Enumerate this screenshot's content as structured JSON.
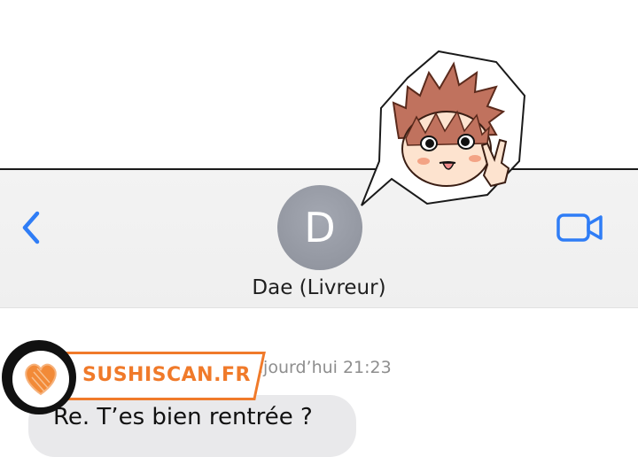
{
  "header": {
    "contact_initial": "D",
    "contact_name": "Dae (Livreur)",
    "back_icon": "chevron-left-icon",
    "video_icon": "video-camera-icon",
    "accent_color": "#2f7df6"
  },
  "conversation": {
    "timestamp": "ujourd’hui 21:23",
    "messages": [
      {
        "text": "Re. T’es bien rentrée ?",
        "direction": "incoming"
      }
    ]
  },
  "watermark": {
    "text": "SUSHISCAN.FR",
    "color": "#f07a2a"
  },
  "sticker": {
    "subject": "chibi boy with tongue out making peace sign"
  }
}
